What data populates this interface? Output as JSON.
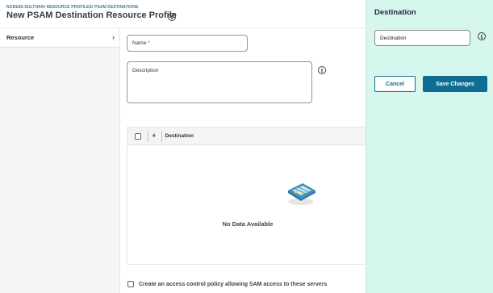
{
  "header": {
    "breadcrumb": "NODE86-SULTHAN/ RESOURCE PROFILES/ PSAM DESTINATIONS",
    "title": "New PSAM Destination Resource Profile"
  },
  "sidebar": {
    "items": [
      {
        "label": "Resource",
        "chevron": "›"
      }
    ]
  },
  "form": {
    "name_label": "Name",
    "required_mark": "*",
    "name_value": "",
    "description_label": "Description",
    "description_value": ""
  },
  "table": {
    "headers": [
      "#",
      "Destination"
    ],
    "rows": [],
    "empty_text": "No Data Available"
  },
  "footer": {
    "access_policy_label": "Create an access control policy allowing SAM access to these servers",
    "access_policy_checked": false
  },
  "panel": {
    "title": "Destination",
    "input_value": "Destination",
    "cancel_label": "Cancel",
    "save_label": "Save Changes"
  },
  "colors": {
    "panel_bg": "#d6f7ee",
    "primary": "#0e6d92",
    "link": "#1f6f9c",
    "required": "#d9302c"
  }
}
